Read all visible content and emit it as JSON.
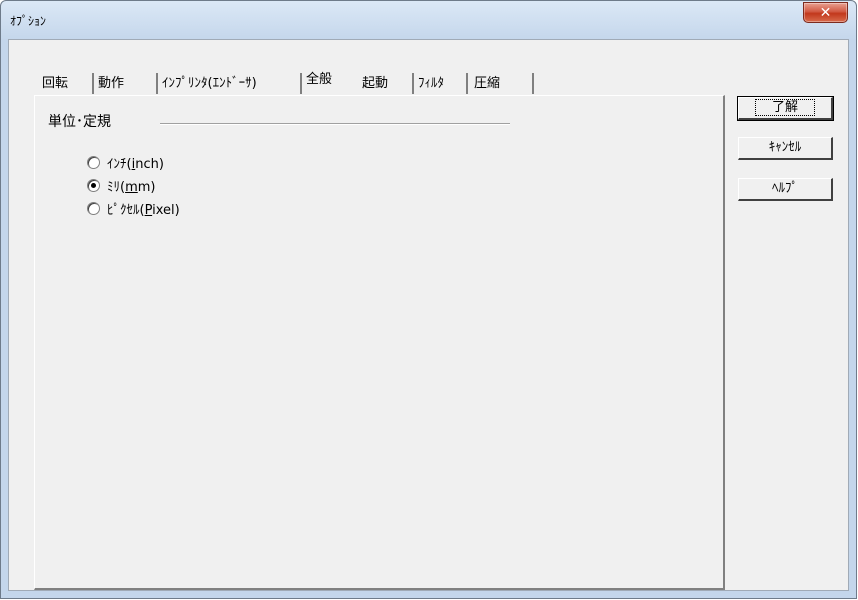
{
  "window": {
    "title": "ｵﾌﾟｼｮﾝ",
    "close_label": "✕"
  },
  "tabs": [
    {
      "label": "回転"
    },
    {
      "label": "動作"
    },
    {
      "label": "ｲﾝﾌﾟﾘﾝﾀ(ｴﾝﾄﾞｰｻ)"
    },
    {
      "label": "全般"
    },
    {
      "label": "起動"
    },
    {
      "label": "ﾌｨﾙﾀ"
    },
    {
      "label": "圧縮"
    }
  ],
  "active_tab": "全般",
  "group": {
    "title": "単位･定規"
  },
  "units": [
    {
      "prefix": "ｲﾝﾁ(",
      "mnemonic": "i",
      "suffix": "nch)",
      "checked": false
    },
    {
      "prefix": "ﾐﾘ(",
      "mnemonic": "m",
      "suffix": "m)",
      "checked": true
    },
    {
      "prefix": "ﾋﾟｸｾﾙ(",
      "mnemonic": "P",
      "suffix": "ixel)",
      "checked": false
    }
  ],
  "buttons": {
    "ok": "了解",
    "cancel": "ｷｬﾝｾﾙ",
    "help": "ﾍﾙﾌﾟ"
  }
}
